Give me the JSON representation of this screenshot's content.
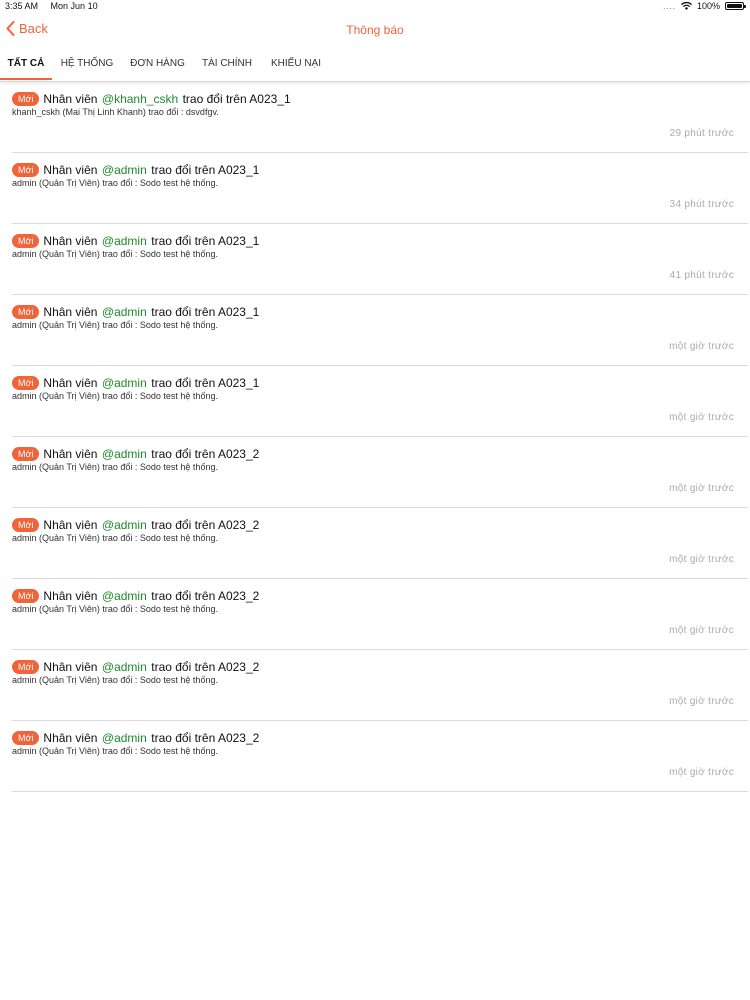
{
  "status_bar": {
    "time": "3:35 AM",
    "date": "Mon Jun 10",
    "signal": "....",
    "battery": "100%"
  },
  "nav": {
    "back_label": "Back",
    "title": "Thông báo"
  },
  "tabs": [
    {
      "label": "TẤT CẢ",
      "active": true
    },
    {
      "label": "HỆ THỐNG",
      "active": false
    },
    {
      "label": "ĐƠN HÀNG",
      "active": false
    },
    {
      "label": "TÀI CHÍNH",
      "active": false
    },
    {
      "label": "KHIẾU NẠI",
      "active": false
    }
  ],
  "notifications": [
    {
      "badge": "Mới",
      "prefix": "Nhân viên",
      "mention": "@khanh_cskh",
      "suffix": "trao đổi trên A023_1",
      "detail": "khanh_cskh (Mai Thị Linh Khanh) trao đổi : dsvdfgv.",
      "time": "29 phút trước"
    },
    {
      "badge": "Mới",
      "prefix": "Nhân viên",
      "mention": "@admin",
      "suffix": "trao đổi trên A023_1",
      "detail": "admin (Quản Trị Viên) trao đổi : Sodo test hệ thống.",
      "time": "34 phút trước"
    },
    {
      "badge": "Mới",
      "prefix": "Nhân viên",
      "mention": "@admin",
      "suffix": "trao đổi trên A023_1",
      "detail": "admin (Quản Trị Viên) trao đổi : Sodo test hệ thống.",
      "time": "41 phút trước"
    },
    {
      "badge": "Mới",
      "prefix": "Nhân viên",
      "mention": "@admin",
      "suffix": "trao đổi trên A023_1",
      "detail": "admin (Quản Trị Viên) trao đổi : Sodo test hệ thống.",
      "time": "một giờ trước"
    },
    {
      "badge": "Mới",
      "prefix": "Nhân viên",
      "mention": "@admin",
      "suffix": "trao đổi trên A023_1",
      "detail": "admin (Quản Trị Viên) trao đổi : Sodo test hệ thống.",
      "time": "một giờ trước"
    },
    {
      "badge": "Mới",
      "prefix": "Nhân viên",
      "mention": "@admin",
      "suffix": "trao đổi trên A023_2",
      "detail": "admin (Quản Trị Viên) trao đổi : Sodo test hệ thống.",
      "time": "một giờ trước"
    },
    {
      "badge": "Mới",
      "prefix": "Nhân viên",
      "mention": "@admin",
      "suffix": "trao đổi trên A023_2",
      "detail": "admin (Quản Trị Viên) trao đổi : Sodo test hệ thống.",
      "time": "một giờ trước"
    },
    {
      "badge": "Mới",
      "prefix": "Nhân viên",
      "mention": "@admin",
      "suffix": "trao đổi trên A023_2",
      "detail": "admin (Quản Trị Viên) trao đổi : Sodo test hệ thống.",
      "time": "một giờ trước"
    },
    {
      "badge": "Mới",
      "prefix": "Nhân viên",
      "mention": "@admin",
      "suffix": "trao đổi trên A023_2",
      "detail": "admin (Quản Trị Viên) trao đổi : Sodo test hệ thống.",
      "time": "một giờ trước"
    },
    {
      "badge": "Mới",
      "prefix": "Nhân viên",
      "mention": "@admin",
      "suffix": "trao đổi trên A023_2",
      "detail": "admin (Quản Trị Viên) trao đổi : Sodo test hệ thống.",
      "time": "một giờ trước"
    }
  ],
  "icons": {
    "back": "chevron-left-icon",
    "wifi": "wifi-icon",
    "battery": "battery-icon"
  },
  "colors": {
    "accent": "#f0643a",
    "mention": "#1e8a2a",
    "time_text": "#aaaaaa"
  }
}
